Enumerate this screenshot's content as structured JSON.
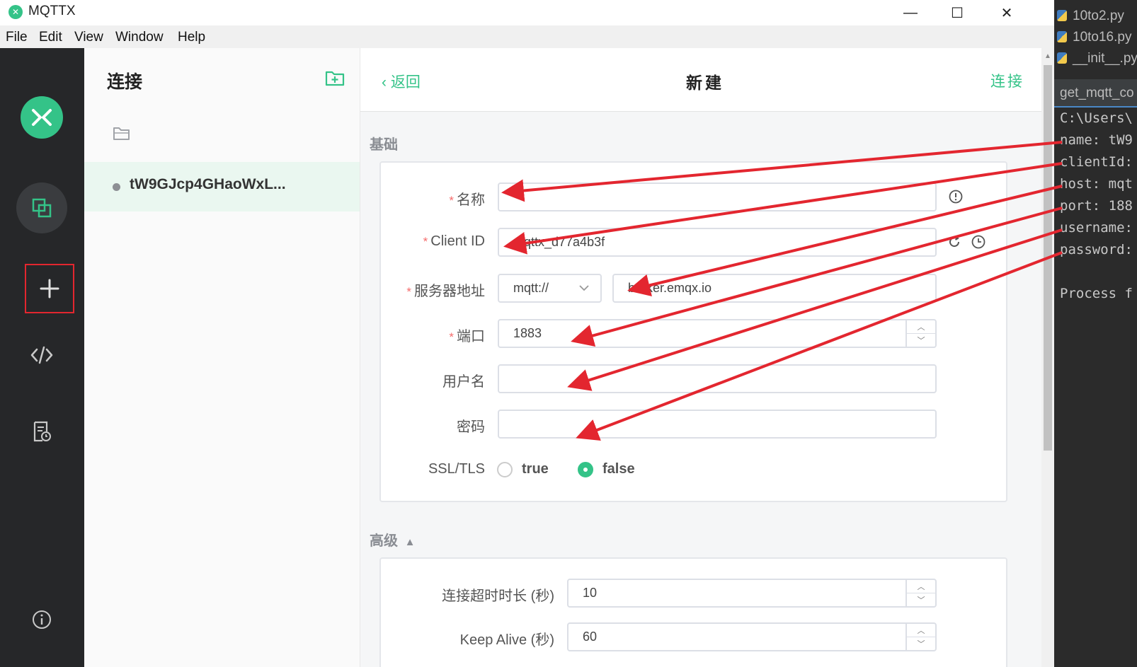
{
  "window": {
    "app_title": "MQTTX",
    "minimize": "—",
    "maximize": "☐",
    "close": "✕"
  },
  "menu": {
    "items": [
      "File",
      "Edit",
      "View",
      "Window",
      "Help"
    ]
  },
  "connections": {
    "heading": "连接",
    "items": [
      {
        "name": "tW9GJcp4GHaoWxL..."
      }
    ]
  },
  "form": {
    "back": "返回",
    "title": "新建",
    "connect": "连接",
    "basic_section": "基础",
    "advanced_section": "高级",
    "fields": {
      "name": {
        "label": "名称",
        "value": ""
      },
      "client_id": {
        "label": "Client ID",
        "value": "mqttx_d77a4b3f"
      },
      "server": {
        "label": "服务器地址",
        "protocol": "mqtt://",
        "host": "broker.emqx.io"
      },
      "port": {
        "label": "端口",
        "value": "1883"
      },
      "username": {
        "label": "用户名",
        "value": ""
      },
      "password": {
        "label": "密码",
        "value": ""
      },
      "ssl": {
        "label": "SSL/TLS",
        "options": [
          "true",
          "false"
        ],
        "selected": "false"
      },
      "connect_timeout": {
        "label": "连接超时时长 (秒)",
        "value": "10"
      },
      "keep_alive": {
        "label": "Keep Alive (秒)",
        "value": "60"
      }
    }
  },
  "ide": {
    "files": [
      "10to2.py",
      "10to16.py",
      "__init__.py"
    ],
    "tab": "get_mqtt_co",
    "terminal": [
      "C:\\Users\\",
      "name: tW9",
      "clientId:",
      "host: mqt",
      "port: 188",
      "username:",
      "password:",
      "",
      "Process f"
    ]
  },
  "colors": {
    "accent": "#34c388",
    "required": "#f56c6c",
    "annotation": "#e3262f",
    "rail": "#262729"
  }
}
